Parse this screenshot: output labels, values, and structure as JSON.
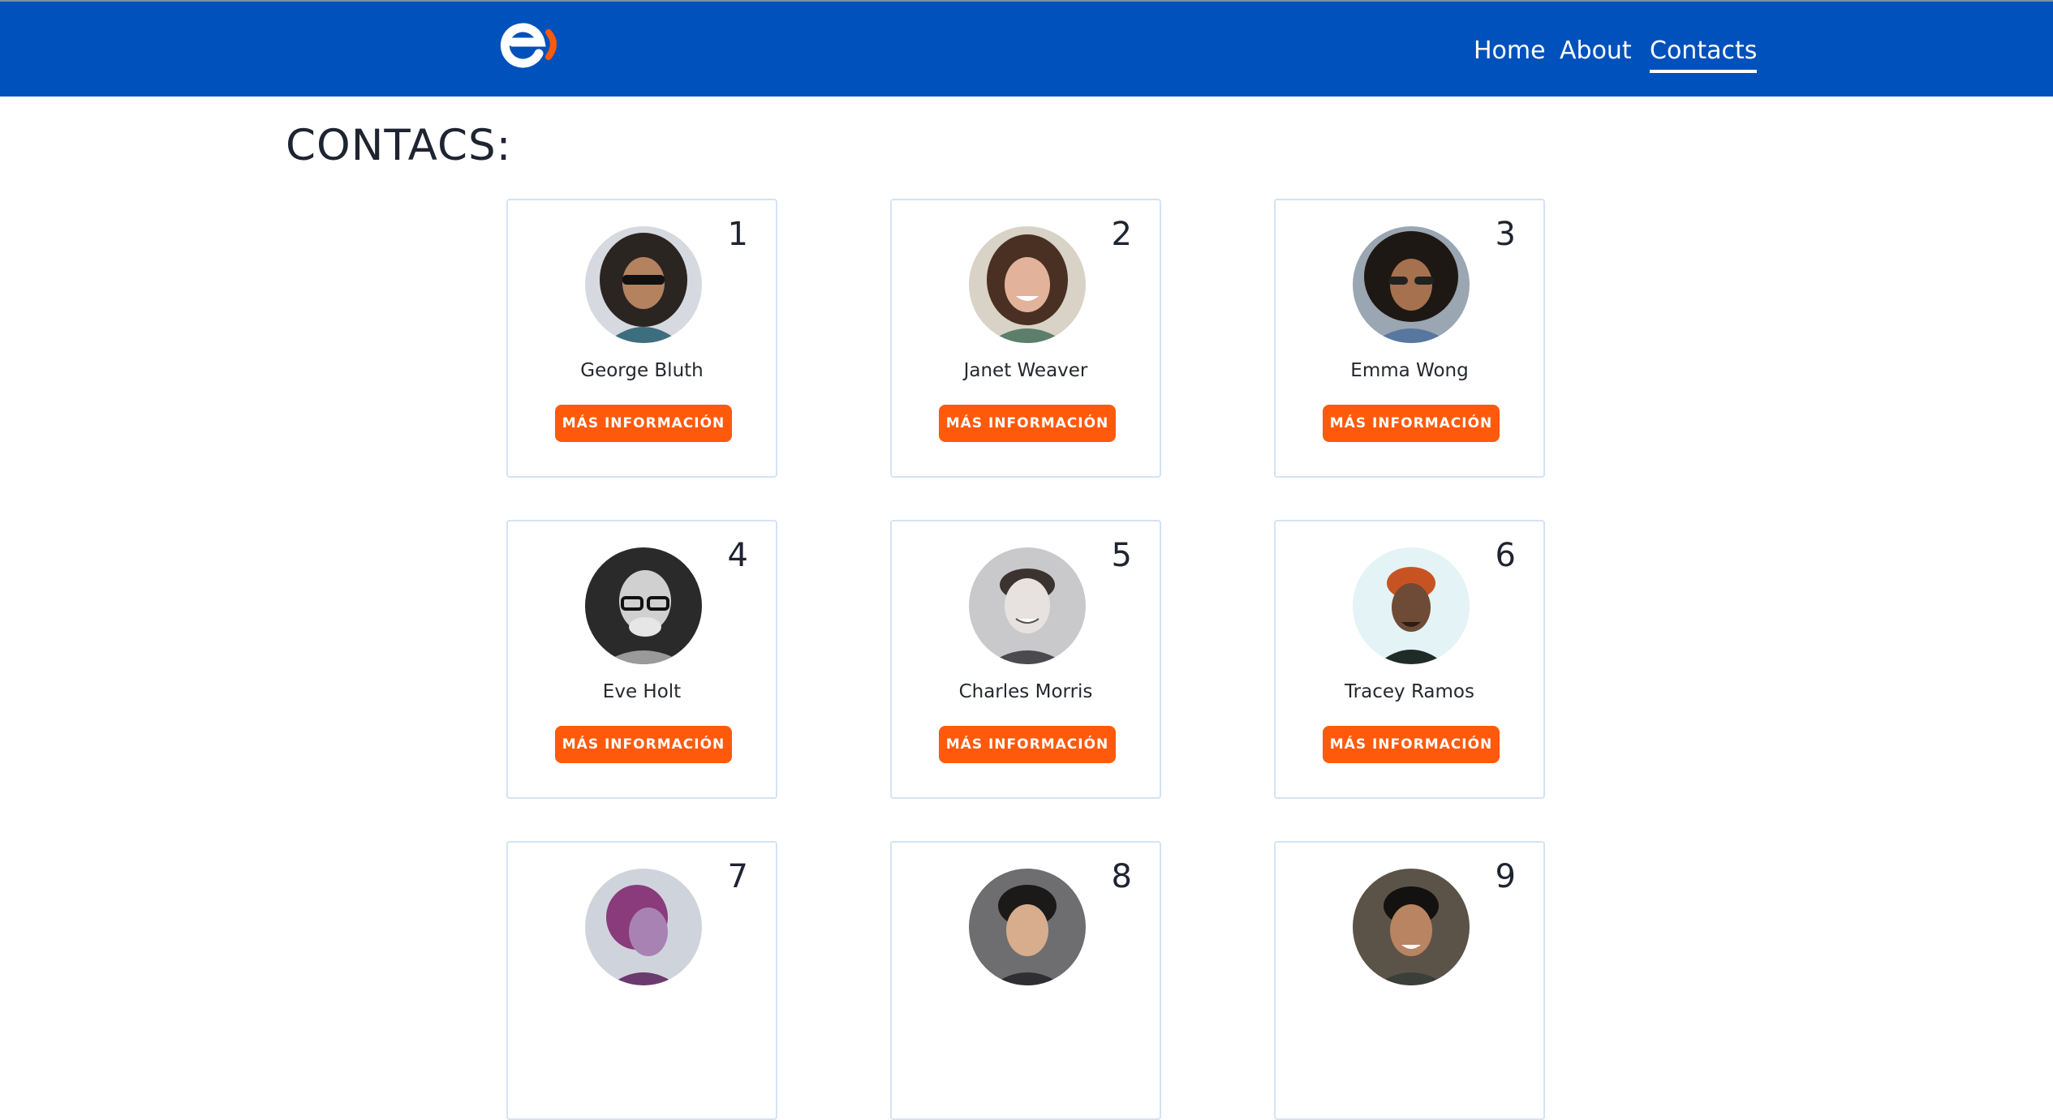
{
  "nav": {
    "logo_icon": "entel-logo-icon",
    "links": [
      {
        "label": "Home"
      },
      {
        "label": "About"
      },
      {
        "label": "Contacts",
        "active": true
      }
    ]
  },
  "page": {
    "title": "CONTACS:"
  },
  "contacts": [
    {
      "index": "1",
      "name": "George Bluth",
      "button": "MÁS INFORMACIÓN"
    },
    {
      "index": "2",
      "name": "Janet Weaver",
      "button": "MÁS INFORMACIÓN"
    },
    {
      "index": "3",
      "name": "Emma Wong",
      "button": "MÁS INFORMACIÓN"
    },
    {
      "index": "4",
      "name": "Eve Holt",
      "button": "MÁS INFORMACIÓN"
    },
    {
      "index": "5",
      "name": "Charles Morris",
      "button": "MÁS INFORMACIÓN"
    },
    {
      "index": "6",
      "name": "Tracey Ramos",
      "button": "MÁS INFORMACIÓN"
    },
    {
      "index": "7",
      "name": "",
      "button": ""
    },
    {
      "index": "8",
      "name": "",
      "button": ""
    },
    {
      "index": "9",
      "name": "",
      "button": ""
    }
  ],
  "colors": {
    "navbar": "#0051bb",
    "accent": "#ff5a0c",
    "card_border": "#d4e3f4"
  }
}
